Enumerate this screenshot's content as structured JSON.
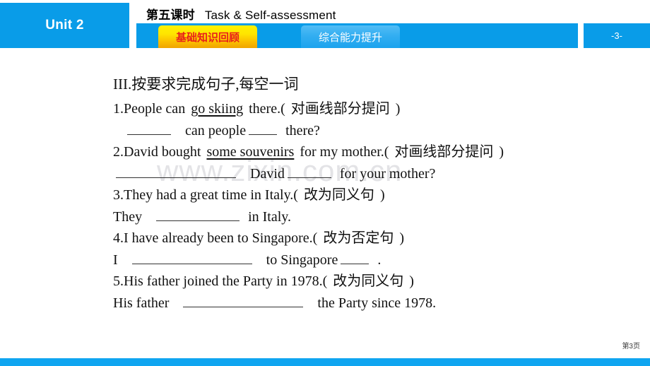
{
  "header": {
    "unit_label": "Unit 2",
    "lesson_title_cn": "第五课时",
    "lesson_title_en": "Task & Self-assessment",
    "page_indicator": "-3-",
    "tabs": [
      {
        "label": "基础知识回顾",
        "active": true
      },
      {
        "label": "综合能力提升",
        "active": false
      }
    ]
  },
  "colors": {
    "brand_blue": "#099CE8",
    "tab_active_start": "#FFF200",
    "tab_active_end": "#EFA400",
    "tab_active_text": "#E8201A",
    "tab_inactive_blue": "#33AEF1",
    "watermark_gray": "#E3E3E6",
    "footer_bar": "#0FA5F0"
  },
  "watermark": {
    "text": "www.zixin.com.cn"
  },
  "exercise": {
    "heading": "III.按要求完成句子,每空一词",
    "items": [
      {
        "number": "1.",
        "prompt_before": "People can",
        "prompt_underlined": "go skiing",
        "prompt_after": "there.(",
        "instruction": "对画线部分提问",
        "close_paren": ")",
        "answer_parts": [
          "",
          "can people",
          "",
          "there?"
        ]
      },
      {
        "number": "2.",
        "prompt_before": "David bought",
        "prompt_underlined": "some souvenirs",
        "prompt_after": "for my mother.(",
        "instruction": "对画线部分提问",
        "close_paren": ")",
        "answer_parts": [
          "",
          "David",
          "",
          "for your mother?"
        ]
      },
      {
        "number": "3.",
        "prompt_before": "They had a great time in Italy.(",
        "prompt_underlined": "",
        "prompt_after": "",
        "instruction": "改为同义句",
        "close_paren": ")",
        "answer_parts": [
          "They",
          "",
          "in Italy."
        ]
      },
      {
        "number": "4.",
        "prompt_before": "I have already been to Singapore.(",
        "prompt_underlined": "",
        "prompt_after": "",
        "instruction": "改为否定句",
        "close_paren": ")",
        "answer_parts": [
          "I",
          "",
          "to Singapore",
          "",
          "."
        ]
      },
      {
        "number": "5.",
        "prompt_before": "His father joined the Party in 1978.(",
        "prompt_underlined": "",
        "prompt_after": "",
        "instruction": "改为同义句",
        "close_paren": ")",
        "answer_parts": [
          "His father",
          "",
          "the Party since 1978."
        ]
      }
    ]
  },
  "footer": {
    "page_label": "第3页"
  }
}
